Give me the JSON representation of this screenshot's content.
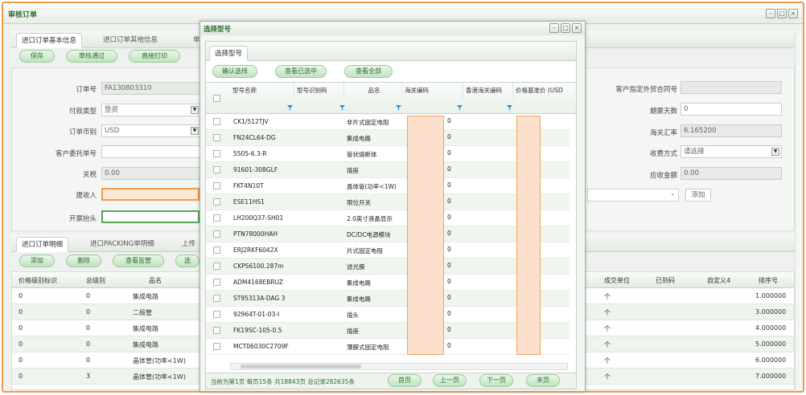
{
  "window": {
    "title": "审核订单"
  },
  "main_tabs": [
    "进口订单基本信息",
    "进口订单其他信息",
    "单"
  ],
  "main_buttons": [
    "保存",
    "审核通过",
    "直接打印"
  ],
  "form": {
    "order_no_label": "订单号",
    "order_no": "FA130803310",
    "pay_type_label": "付款类型",
    "pay_type": "垫资",
    "currency_label": "订单币别",
    "currency": "USD",
    "client_po_label": "客户委托单号",
    "client_po": "",
    "tariff_label": "关税",
    "tariff": "0.00",
    "receiver_label": "提收人",
    "receiver": "",
    "invoice_label": "开票抬头",
    "invoice": "",
    "client_contract_label": "客户指定外贸合同号",
    "client_contract": "",
    "days_label": "期票天数",
    "days": "0",
    "rate_label": "海关汇率",
    "rate": "6.165200",
    "collect_label": "收费方式",
    "collect": "请选择",
    "receivable_label": "应收金额",
    "receivable": "0.00",
    "add_label": "添加"
  },
  "detail_tabs": [
    "进口订单明细",
    "进口PACKING单明细",
    "上传"
  ],
  "detail_buttons": [
    "添加",
    "删除",
    "查看监管",
    "选"
  ],
  "detail_grid": {
    "left_headers": [
      "价格级别标识",
      "总级别",
      "品名"
    ],
    "right_headers": [
      "成交单位",
      "已到码",
      "自定义4",
      "排序号"
    ],
    "rows": [
      {
        "c1": "0",
        "c2": "0",
        "name": "集成电路",
        "unit": "个",
        "seq": "1.000000"
      },
      {
        "c1": "0",
        "c2": "0",
        "name": "二极管",
        "unit": "个",
        "seq": "3.000000"
      },
      {
        "c1": "0",
        "c2": "0",
        "name": "集成电路",
        "unit": "个",
        "seq": "4.000000"
      },
      {
        "c1": "0",
        "c2": "0",
        "name": "集成电路",
        "unit": "个",
        "seq": "5.000000"
      },
      {
        "c1": "0",
        "c2": "0",
        "name": "晶体管(功率<1W)",
        "unit": "个",
        "seq": "6.000000"
      },
      {
        "c1": "0",
        "c2": "3",
        "name": "晶体管(功率<1W)",
        "unit": "个",
        "seq": "7.000000"
      }
    ]
  },
  "dialog": {
    "title": "选择型号",
    "tab": "选择型号",
    "buttons": [
      "确认选择",
      "查看已选中",
      "查看全部"
    ],
    "headers": [
      "型号名称",
      "型号识别码",
      "品名",
      "海关编码",
      "香港海关编码",
      "价格基准价 (USD"
    ],
    "rows": [
      {
        "model": "CK1/512TJV",
        "name": "非片式固定电阻"
      },
      {
        "model": "FN24CL64-DG",
        "name": "集成电路"
      },
      {
        "model": "5505-6.3-R",
        "name": "管状熔断体"
      },
      {
        "model": "91601-308GLF",
        "name": "插座"
      },
      {
        "model": "FKT4N10T",
        "name": "晶体管(功率<1W)"
      },
      {
        "model": "ESE11HS1",
        "name": "限位开关"
      },
      {
        "model": "LH200Q37-SH01",
        "name": "2.0英寸液晶显示"
      },
      {
        "model": "PTN78000HAH",
        "name": "DC/DC电源模块"
      },
      {
        "model": "ERJ2RKF6042X",
        "name": "片式固定电阻"
      },
      {
        "model": "CKPS6100.287m",
        "name": "滤光膜"
      },
      {
        "model": "ADM4168EBRUZ",
        "name": "集成电路"
      },
      {
        "model": "ST95313A-DAG 3",
        "name": "集成电路"
      },
      {
        "model": "92964T-01-03-I",
        "name": "插头"
      },
      {
        "model": "FK19SC-105-0.5",
        "name": "插座"
      },
      {
        "model": "MCT06030C2709F",
        "name": "薄膜式固定电阻"
      }
    ],
    "status": "当前为第1页 每页15条 共18843页 总记录282635条",
    "pager": [
      "首页",
      "上一页",
      "下一页",
      "末页"
    ]
  },
  "colors": {
    "accent": "#2e6b2e",
    "border_highlight": "#f29a4a",
    "mask": "#fde0cc"
  }
}
